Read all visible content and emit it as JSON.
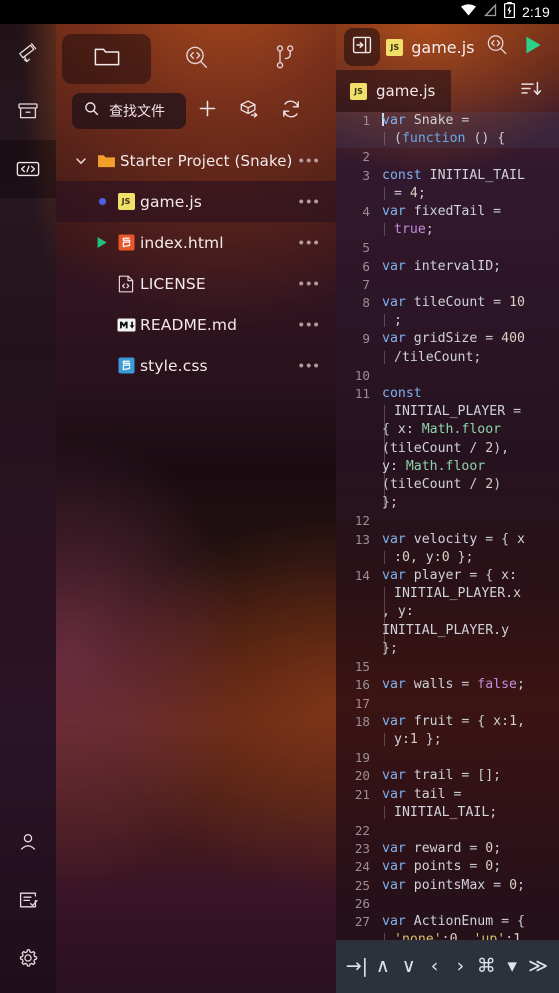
{
  "statusbar": {
    "time": "2:19",
    "icons": [
      "wifi-icon",
      "signal-off-icon",
      "battery-charging-icon"
    ]
  },
  "rail": {
    "top_items": [
      {
        "name": "telescope-icon",
        "label": "Explore",
        "active": false
      },
      {
        "name": "archive-icon",
        "label": "Projects",
        "active": false
      },
      {
        "name": "code-icon",
        "label": "Editor",
        "active": true
      }
    ],
    "bottom_items": [
      {
        "name": "account-icon",
        "label": "Account"
      },
      {
        "name": "tasks-icon",
        "label": "Tasks"
      },
      {
        "name": "settings-gear-icon",
        "label": "Settings"
      }
    ]
  },
  "files_panel": {
    "tabs": [
      {
        "name": "files-tab",
        "icon": "folder-icon",
        "active": true
      },
      {
        "name": "search-code-tab",
        "icon": "code-search-icon",
        "active": false
      },
      {
        "name": "git-tab",
        "icon": "git-branch-icon",
        "active": false
      }
    ],
    "search": {
      "placeholder": "查找文件",
      "value": "查找文件",
      "icon": "search-icon"
    },
    "actions": [
      {
        "name": "new-file-button",
        "icon": "plus-icon"
      },
      {
        "name": "import-package-button",
        "icon": "package-export-icon"
      },
      {
        "name": "refresh-button",
        "icon": "refresh-icon"
      }
    ],
    "project": {
      "label": "Starter Project (Snake)",
      "expanded": true,
      "menu": "•••"
    },
    "items": [
      {
        "label": "game.js",
        "icon": "js-file-icon",
        "badge": "JS",
        "marker": "dot",
        "selected": true,
        "menu": "•••"
      },
      {
        "label": "index.html",
        "icon": "html-file-icon",
        "badge": "5",
        "marker": "play",
        "selected": false,
        "menu": "•••"
      },
      {
        "label": "LICENSE",
        "icon": "license-file-icon",
        "badge": "",
        "marker": "",
        "selected": false,
        "menu": "•••"
      },
      {
        "label": "README.md",
        "icon": "markdown-file-icon",
        "badge": "M↓",
        "marker": "",
        "selected": false,
        "menu": "•••"
      },
      {
        "label": "style.css",
        "icon": "css-file-icon",
        "badge": "3",
        "marker": "",
        "selected": false,
        "menu": "•••"
      }
    ]
  },
  "editor": {
    "header": {
      "panel_toggle": "panel-toggle-icon",
      "filename": "game.js",
      "file_icon": "js-file-icon",
      "search_icon": "code-search-icon",
      "run_icon": "run-play-icon"
    },
    "tab": {
      "label": "game.js",
      "icon": "js-file-icon",
      "active": true
    },
    "sort_icon": "sort-descending-icon",
    "lines": [
      {
        "n": "1",
        "cur": true
      },
      {
        "n": "2"
      },
      {
        "n": "3"
      },
      {
        "n": "4"
      },
      {
        "n": "5"
      },
      {
        "n": "6"
      },
      {
        "n": "7"
      },
      {
        "n": "8"
      },
      {
        "n": "9"
      },
      {
        "n": "10"
      },
      {
        "n": "11"
      },
      {
        "n": "12"
      },
      {
        "n": "13"
      },
      {
        "n": "14"
      },
      {
        "n": "15"
      },
      {
        "n": "16"
      },
      {
        "n": "17"
      },
      {
        "n": "18"
      },
      {
        "n": "19"
      },
      {
        "n": "20"
      },
      {
        "n": "21"
      },
      {
        "n": "22"
      },
      {
        "n": "23"
      },
      {
        "n": "24"
      },
      {
        "n": "25"
      },
      {
        "n": "26"
      },
      {
        "n": "27"
      }
    ],
    "source_text": [
      "var Snake = (function () {",
      "",
      "const INITIAL_TAIL = 4;",
      "var fixedTail = true;",
      "",
      "var intervalID;",
      "",
      "var tileCount = 10;",
      "var gridSize = 400/tileCount;",
      "",
      "const INITIAL_PLAYER = { x: Math.floor(tileCount / 2), y: Math.floor(tileCount / 2) };",
      "",
      "var velocity = { x:0, y:0 };",
      "var player = { x: INITIAL_PLAYER.x, y: INITIAL_PLAYER.y };",
      "",
      "var walls = false;",
      "",
      "var fruit = { x:1, y:1 };",
      "",
      "var trail = [];",
      "var tail = INITIAL_TAIL;",
      "",
      "var reward = 0;",
      "var points = 0;",
      "var pointsMax = 0;",
      "",
      "var ActionEnum = { 'none':0, 'up':1"
    ]
  },
  "keyboard_bar": {
    "buttons": [
      {
        "name": "tab-key-button",
        "glyph": "→|"
      },
      {
        "name": "arrow-up-key-button",
        "glyph": "∧"
      },
      {
        "name": "arrow-down-key-button",
        "glyph": "∨"
      },
      {
        "name": "arrow-left-key-button",
        "glyph": "‹"
      },
      {
        "name": "arrow-right-key-button",
        "glyph": "›"
      },
      {
        "name": "command-key-button",
        "glyph": "⌘"
      },
      {
        "name": "dropdown-key-button",
        "glyph": "▾"
      },
      {
        "name": "more-keys-button",
        "glyph": "≫"
      }
    ]
  },
  "colors": {
    "accent_orange": "#c4581e",
    "run_green": "#2bd18a",
    "js_yellow": "#f0e06a",
    "html_orange": "#e8562a",
    "css_blue": "#3a9bd9",
    "keyword_blue": "#7fb2ef",
    "string_yellow": "#d6c36a",
    "bool_purple": "#c58bdd",
    "keyboard_bar_bg": "#2c313c"
  }
}
